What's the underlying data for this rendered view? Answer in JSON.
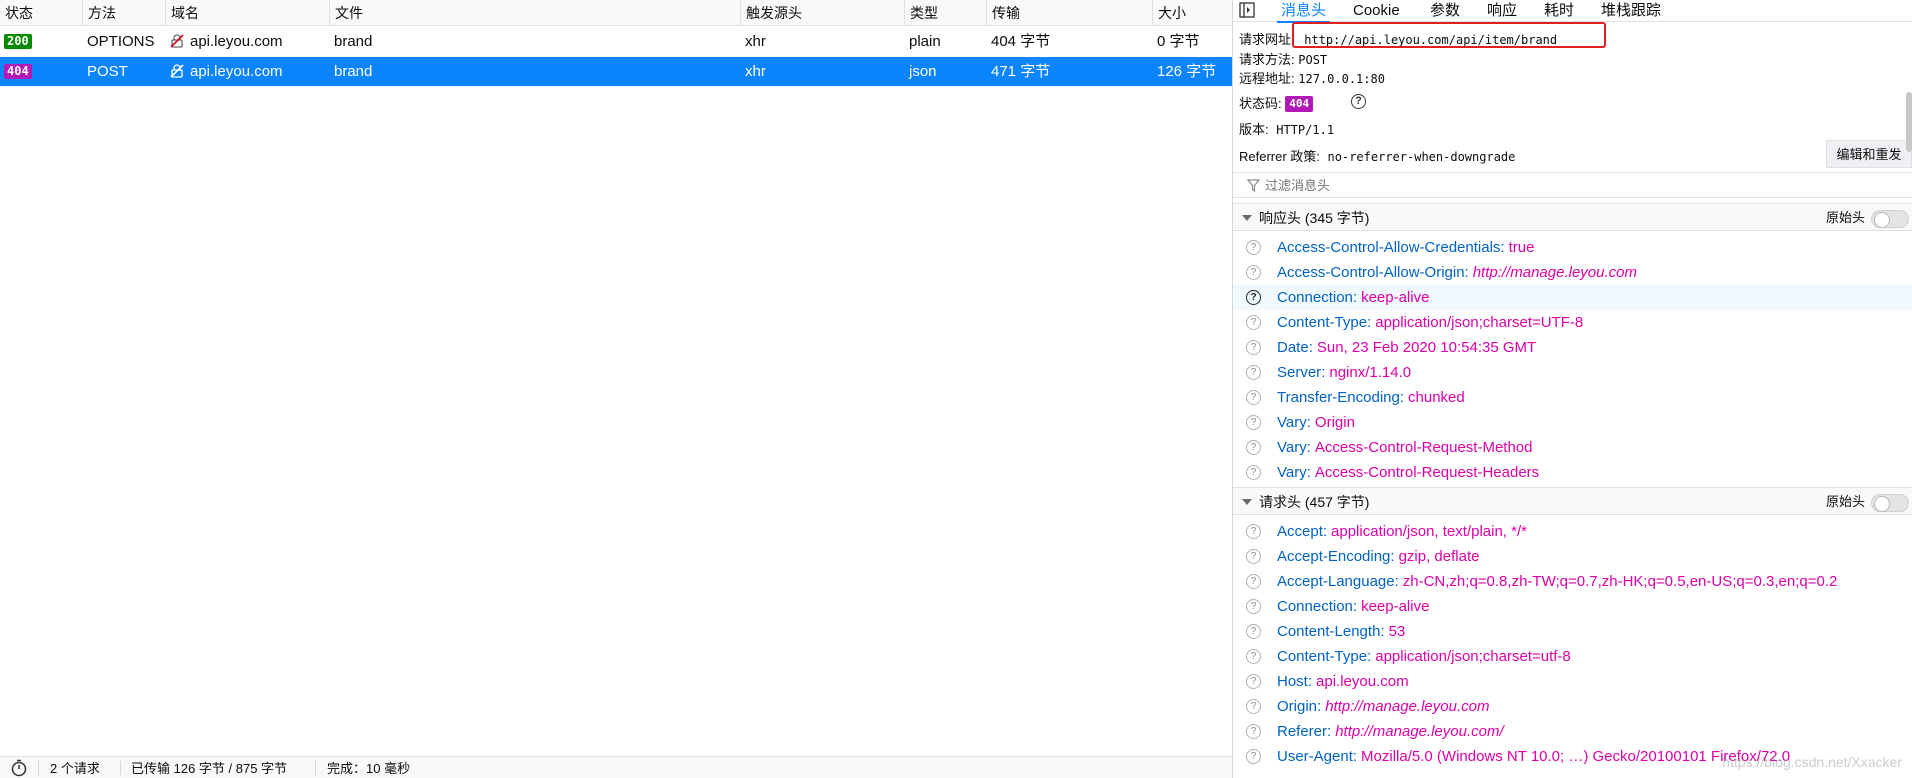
{
  "columns": [
    "状态",
    "方法",
    "域名",
    "文件",
    "触发源头",
    "类型",
    "传输",
    "大小"
  ],
  "requests": [
    {
      "status": "200",
      "method": "OPTIONS",
      "domain": "api.leyou.com",
      "file": "brand",
      "cause": "xhr",
      "type": "plain",
      "transferred": "404 字节",
      "size": "0 字节",
      "selected": false
    },
    {
      "status": "404",
      "method": "POST",
      "domain": "api.leyou.com",
      "file": "brand",
      "cause": "xhr",
      "type": "json",
      "transferred": "471 字节",
      "size": "126 字节",
      "selected": true
    }
  ],
  "footer": {
    "requests": "2 个请求",
    "transferred": "已传输 126 字节 / 875 字节",
    "finish": "完成：10 毫秒"
  },
  "tabs": [
    "消息头",
    "Cookie",
    "参数",
    "响应",
    "耗时",
    "堆栈跟踪"
  ],
  "active_tab": "消息头",
  "summary": {
    "url_label": "请求网址:",
    "url": "http://api.leyou.com/api/item/brand",
    "method_label": "请求方法:",
    "method": "POST",
    "remote_label": "远程地址:",
    "remote": "127.0.0.1:80",
    "status_label": "状态码:",
    "status": "404",
    "version_label": "版本:",
    "version": "HTTP/1.1",
    "referrer_label": "Referrer 政策:",
    "referrer": "no-referrer-when-downgrade",
    "resend_label": "编辑和重发"
  },
  "filter_placeholder": "过滤消息头",
  "response_section": {
    "title": "响应头 (345 字节)",
    "raw_label": "原始头"
  },
  "response_headers": [
    {
      "k": "Access-Control-Allow-Credentials",
      "v": "true",
      "url": false
    },
    {
      "k": "Access-Control-Allow-Origin",
      "v": "http://manage.leyou.com",
      "url": true
    },
    {
      "k": "Connection",
      "v": "keep-alive",
      "url": false
    },
    {
      "k": "Content-Type",
      "v": "application/json;charset=UTF-8",
      "url": false
    },
    {
      "k": "Date",
      "v": "Sun, 23 Feb 2020 10:54:35 GMT",
      "url": false
    },
    {
      "k": "Server",
      "v": "nginx/1.14.0",
      "url": false
    },
    {
      "k": "Transfer-Encoding",
      "v": "chunked",
      "url": false
    },
    {
      "k": "Vary",
      "v": "Origin",
      "url": false
    },
    {
      "k": "Vary",
      "v": "Access-Control-Request-Method",
      "url": false
    },
    {
      "k": "Vary",
      "v": "Access-Control-Request-Headers",
      "url": false
    }
  ],
  "request_section": {
    "title": "请求头 (457 字节)",
    "raw_label": "原始头"
  },
  "request_headers": [
    {
      "k": "Accept",
      "v": "application/json, text/plain, */*",
      "url": false
    },
    {
      "k": "Accept-Encoding",
      "v": "gzip, deflate",
      "url": false
    },
    {
      "k": "Accept-Language",
      "v": "zh-CN,zh;q=0.8,zh-TW;q=0.7,zh-HK;q=0.5,en-US;q=0.3,en;q=0.2",
      "url": false
    },
    {
      "k": "Connection",
      "v": "keep-alive",
      "url": false
    },
    {
      "k": "Content-Length",
      "v": "53",
      "url": false
    },
    {
      "k": "Content-Type",
      "v": "application/json;charset=utf-8",
      "url": false
    },
    {
      "k": "Host",
      "v": "api.leyou.com",
      "url": false
    },
    {
      "k": "Origin",
      "v": "http://manage.leyou.com",
      "url": true
    },
    {
      "k": "Referer",
      "v": "http://manage.leyou.com/",
      "url": true
    },
    {
      "k": "User-Agent",
      "v": "Mozilla/5.0 (Windows NT 10.0; …) Gecko/20100101 Firefox/72.0",
      "url": false
    }
  ],
  "watermark": "https://blog.csdn.net/Xxacker"
}
